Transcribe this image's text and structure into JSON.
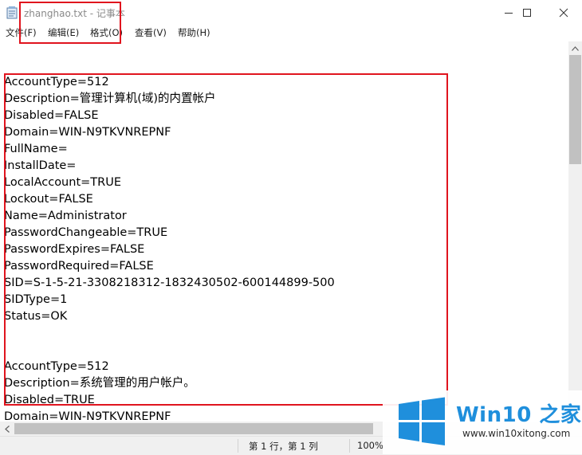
{
  "window": {
    "title": "zhanghao.txt - 记事本"
  },
  "menu": [
    {
      "label": "文件(F)"
    },
    {
      "label": "编辑(E)"
    },
    {
      "label": "格式(O)"
    },
    {
      "label": "查看(V)"
    },
    {
      "label": "帮助(H)"
    }
  ],
  "editor": {
    "lines": [
      "AccountType=512",
      "Description=管理计算机(域)的内置帐户",
      "Disabled=FALSE",
      "Domain=WIN-N9TKVNREPNF",
      "FullName=",
      "InstallDate=",
      "LocalAccount=TRUE",
      "Lockout=FALSE",
      "Name=Administrator",
      "PasswordChangeable=TRUE",
      "PasswordExpires=FALSE",
      "PasswordRequired=FALSE",
      "SID=S-1-5-21-3308218312-1832430502-600144899-500",
      "SIDType=1",
      "Status=OK",
      "",
      "",
      "AccountType=512",
      "Description=系统管理的用户帐户。",
      "Disabled=TRUE",
      "Domain=WIN-N9TKVNREPNF"
    ]
  },
  "status": {
    "position": "第 1 行，第 1 列",
    "zoom": "100%"
  },
  "watermark": {
    "title": "Win10 之家",
    "url": "www.win10xitong.com"
  },
  "colors": {
    "highlight": "#e0141e",
    "watermark_blue": "#1f8fdc"
  }
}
